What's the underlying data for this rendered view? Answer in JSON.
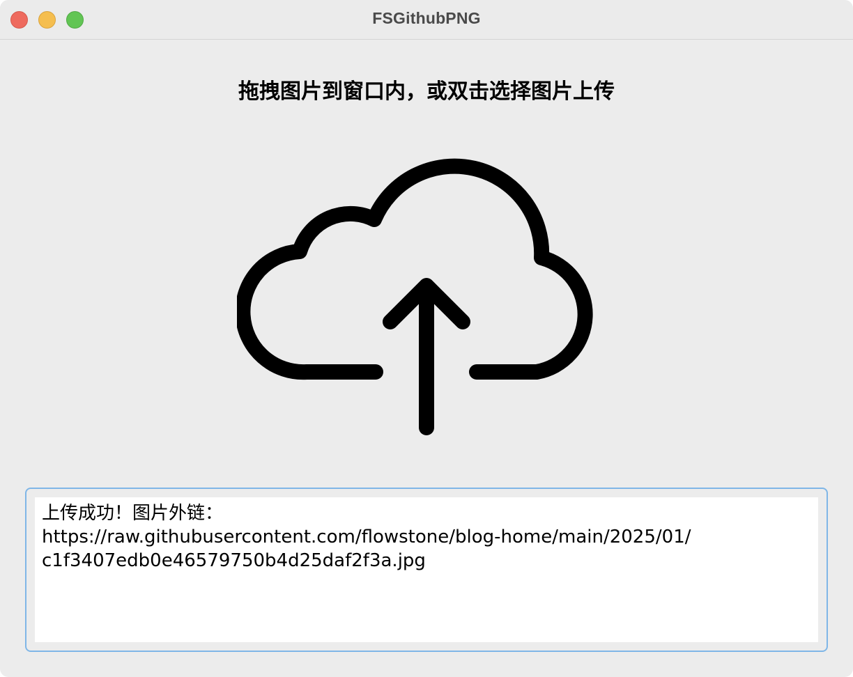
{
  "window": {
    "title": "FSGithubPNG"
  },
  "main": {
    "instruction": "拖拽图片到窗口内，或双击选择图片上传",
    "drop_zone_icon": "cloud-upload-icon"
  },
  "result": {
    "lines": [
      "上传成功！图片外链：",
      "https://raw.githubusercontent.com/flowstone/blog-home/main/2025/01/",
      "c1f3407edb0e46579750b4d25daf2f3a.jpg"
    ]
  },
  "colors": {
    "window_bg": "#ececec",
    "close": "#ee6a5e",
    "minimize": "#f5be4f",
    "zoom": "#62c554",
    "focus_border": "#7fb6e7"
  }
}
